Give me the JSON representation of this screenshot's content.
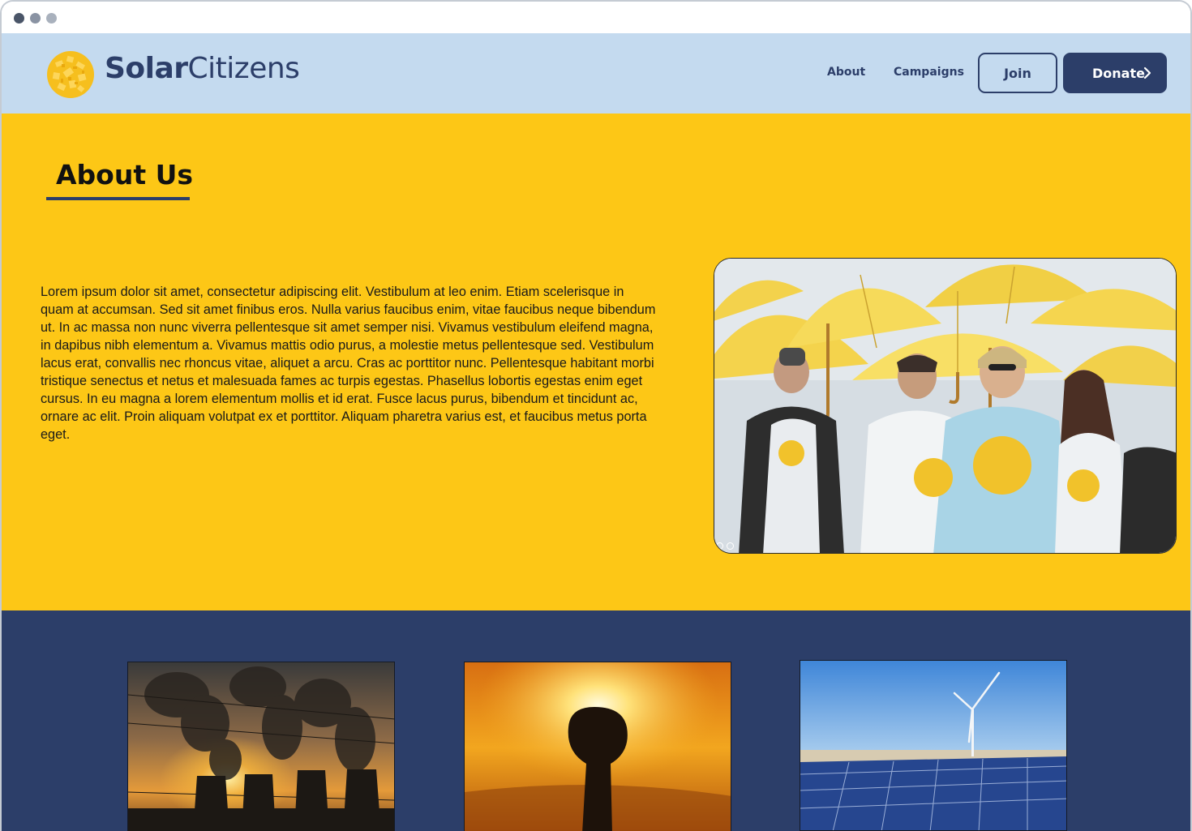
{
  "brand": {
    "name_bold": "Solar",
    "name_regular": "Citizens",
    "accent_color": "#fdc716",
    "primary_color": "#2c3e69",
    "header_color": "#c4daef"
  },
  "nav": {
    "links": [
      {
        "label": "About"
      },
      {
        "label": "Campaigns"
      }
    ],
    "join_label": "Join",
    "donate_label": "Donate"
  },
  "about": {
    "title": "About Us",
    "body": "Lorem ipsum dolor sit amet, consectetur adipiscing elit. Vestibulum at leo enim. Etiam scelerisque in quam at accumsan. Sed sit amet finibus eros. Nulla varius faucibus enim, vitae faucibus neque bibendum ut. In ac massa non nunc viverra pellentesque sit amet semper nisi. Vivamus vestibulum eleifend magna, in dapibus nibh elementum a. Vivamus mattis odio purus, a molestie metus pellentesque sed. Vestibulum lacus erat, convallis nec rhoncus vitae, aliquet a arcu. Cras ac porttitor nunc. Pellentesque habitant morbi tristique senectus et netus et malesuada fames ac turpis egestas. Phasellus lobortis egestas enim eget cursus. In eu magna a lorem elementum mollis et id erat. Fusce lacus purus, bibendum et tincidunt ac, ornare ac elit. Proin aliquam volutpat ex et porttitor. Aliquam pharetra varius est, et faucibus metus porta eget."
  },
  "icons": [
    "solar-citizens-logo-icon",
    "chevron-right-icon"
  ]
}
